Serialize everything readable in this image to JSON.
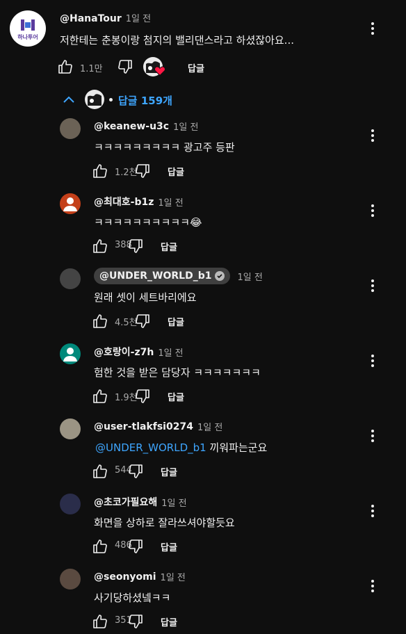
{
  "top_comment": {
    "author": "@HanaTour",
    "time": "1일 전",
    "text": "저한테는 춘봉이랑 첨지의 밸리댄스라고 하셨잖아요...",
    "likes": "1.1만",
    "reply_label": "답글",
    "logo_text": "하나투어",
    "logo_color": "#5a3b9e"
  },
  "replies_toggle": {
    "label": "답글 159개",
    "color": "#3ea6ff"
  },
  "replies": [
    {
      "author": "@keanew-u3c",
      "time": "1일 전",
      "text": "ㅋㅋㅋㅋㅋㅋㅋㅋㅋ 광고주 등판",
      "likes": "1.2천",
      "reply_label": "답글",
      "avatar_color": "#6b6256"
    },
    {
      "author": "@최대호-b1z",
      "time": "1일 전",
      "text": "ㅋㅋㅋㅋㅋㅋㅋㅋㅋㅋ😂",
      "likes": "388",
      "reply_label": "답글",
      "avatar_color": "#c4401a"
    },
    {
      "author": "@UNDER_WORLD_b1",
      "time": "1일 전",
      "text": "원래 셋이 세트바리에요",
      "likes": "4.5천",
      "reply_label": "답글",
      "verified": true,
      "avatar_color": "#444444"
    },
    {
      "author": "@호랑이-z7h",
      "time": "1일 전",
      "text": "험한 것을 받은 담당자 ㅋㅋㅋㅋㅋㅋㅋ",
      "likes": "1.9천",
      "reply_label": "답글",
      "avatar_color": "#00897b"
    },
    {
      "author": "@user-tlakfsi0274",
      "time": "1일 전",
      "mention": "@UNDER_WORLD_b1",
      "text": "끼워파는군요",
      "likes": "544",
      "reply_label": "답글",
      "avatar_color": "#9b9484"
    },
    {
      "author": "@초코가필요해",
      "time": "1일 전",
      "text": "화면을 상하로 잘라쓰셔야할듯요",
      "likes": "486",
      "reply_label": "답글",
      "avatar_color": "#2a2d4a"
    },
    {
      "author": "@seonyomi",
      "time": "1일 전",
      "text": "사기당하셨넼ㅋㅋ",
      "likes": "351",
      "reply_label": "답글",
      "avatar_color": "#5a4a40"
    }
  ]
}
